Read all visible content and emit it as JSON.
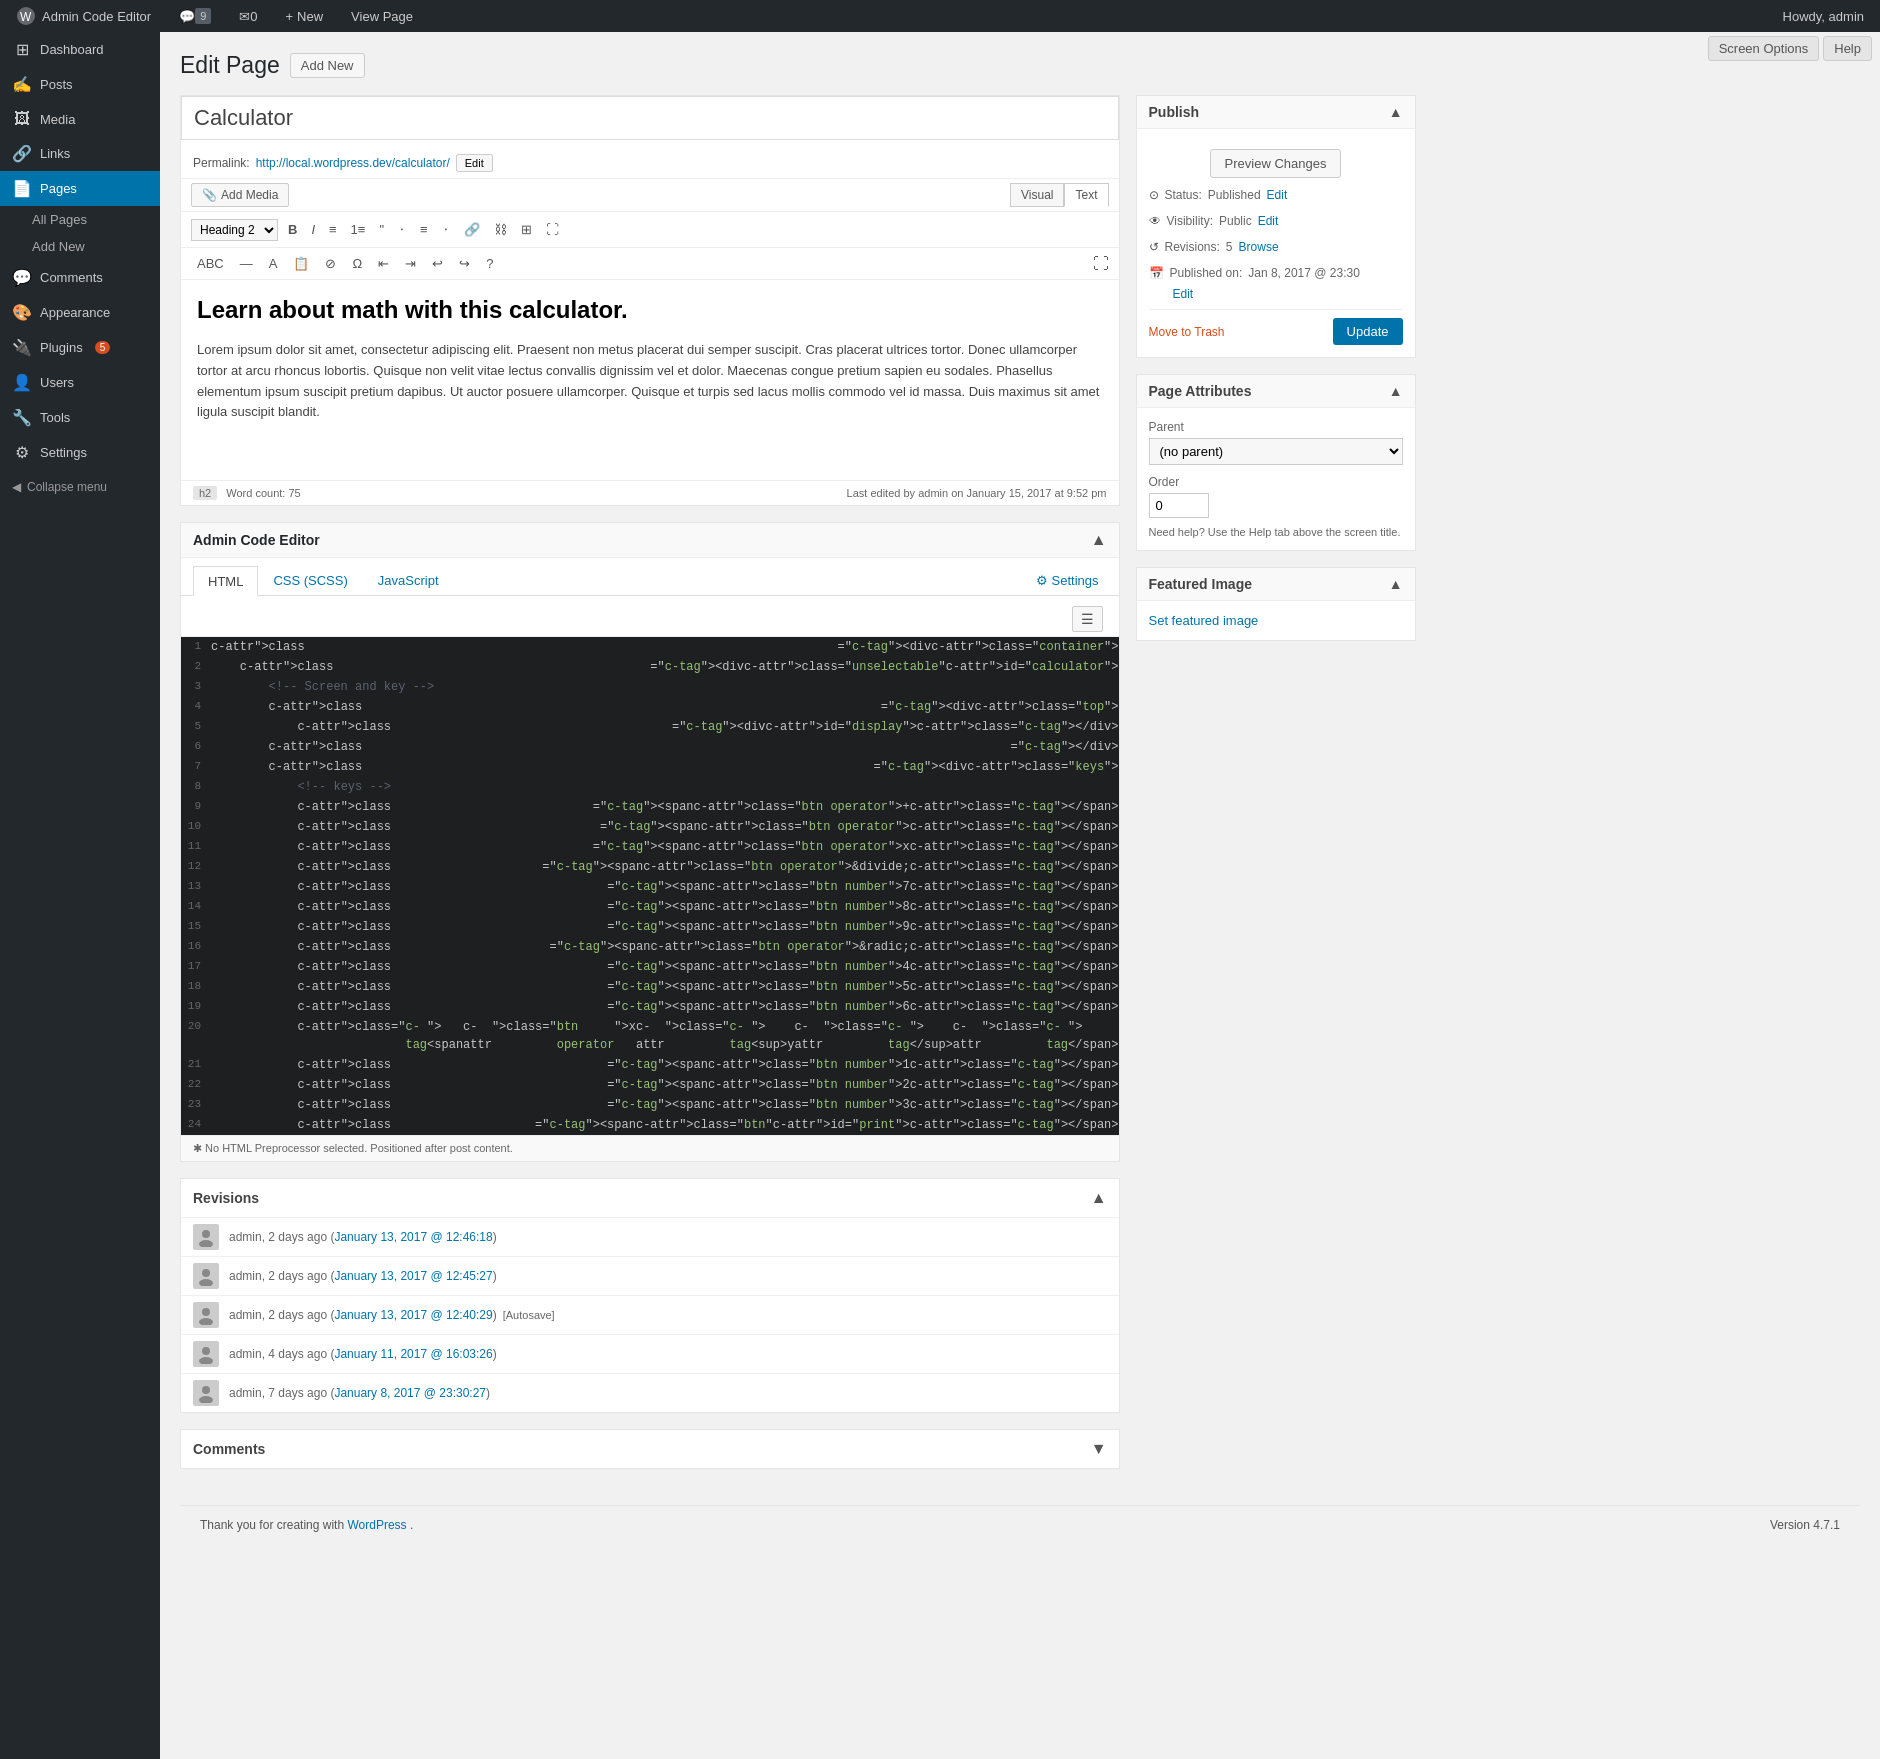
{
  "adminbar": {
    "site_name": "Admin Code Editor",
    "comments_count": "9",
    "new_label": "New",
    "view_page_label": "View Page",
    "screen_options_label": "Screen Options",
    "help_label": "Help",
    "howdy": "Howdy, admin"
  },
  "sidebar": {
    "items": [
      {
        "id": "dashboard",
        "label": "Dashboard",
        "icon": "⊞"
      },
      {
        "id": "posts",
        "label": "Posts",
        "icon": "✍"
      },
      {
        "id": "media",
        "label": "Media",
        "icon": "🖼"
      },
      {
        "id": "links",
        "label": "Links",
        "icon": "🔗"
      },
      {
        "id": "pages",
        "label": "Pages",
        "icon": "📄",
        "active": true
      },
      {
        "id": "comments",
        "label": "Comments",
        "icon": "💬"
      },
      {
        "id": "appearance",
        "label": "Appearance",
        "icon": "🎨"
      },
      {
        "id": "plugins",
        "label": "Plugins",
        "icon": "🔌",
        "badge": "5"
      },
      {
        "id": "users",
        "label": "Users",
        "icon": "👤"
      },
      {
        "id": "tools",
        "label": "Tools",
        "icon": "🔧"
      },
      {
        "id": "settings",
        "label": "Settings",
        "icon": "⚙"
      }
    ],
    "pages_submenu": [
      {
        "label": "All Pages"
      },
      {
        "label": "Add New"
      }
    ],
    "collapse_label": "Collapse menu"
  },
  "page": {
    "header": "Edit Page",
    "add_new": "Add New",
    "title": "Calculator",
    "permalink_label": "Permalink:",
    "permalink_url": "http://local.wordpress.dev/calculator/",
    "permalink_edit": "Edit",
    "add_media": "Add Media",
    "visual_tab": "Visual",
    "text_tab": "Text",
    "heading_select": "Heading 2",
    "editor_content": {
      "heading": "Learn about math with this calculator.",
      "body": "Lorem ipsum dolor sit amet, consectetur adipiscing elit. Praesent non metus placerat dui semper suscipit. Cras placerat ultrices tortor. Donec ullamcorper tortor at arcu rhoncus lobortis. Quisque non velit vitae lectus convallis dignissim vel et dolor. Maecenas congue pretium sapien eu sodales. Phasellus elementum ipsum suscipit pretium dapibus. Ut auctor posuere ullamcorper. Quisque et turpis sed lacus mollis commodo vel id massa. Duis maximus sit amet ligula suscipit blandit."
    },
    "tag_label": "h2",
    "word_count": "Word count: 75",
    "last_edited": "Last edited by admin on January 15, 2017 at 9:52 pm"
  },
  "code_editor": {
    "title": "Admin Code Editor",
    "tabs": [
      "HTML",
      "CSS (SCSS)",
      "JavaScript"
    ],
    "settings_label": "Settings",
    "active_tab": "HTML",
    "lines": [
      {
        "num": 1,
        "text": "<div class=\"container\">"
      },
      {
        "num": 2,
        "text": "    <div class=\"unselectable\" id=\"calculator\">"
      },
      {
        "num": 3,
        "text": "        <!-- Screen and key -->"
      },
      {
        "num": 4,
        "text": "        <div class=\"top\">"
      },
      {
        "num": 5,
        "text": "            <div id=\"display\"></div>"
      },
      {
        "num": 6,
        "text": "        </div>"
      },
      {
        "num": 7,
        "text": "        <div class=\"keys\">"
      },
      {
        "num": 8,
        "text": "            <!-- keys -->"
      },
      {
        "num": 9,
        "text": "            <span class=\"btn operator\">+</span>"
      },
      {
        "num": 10,
        "text": "            <span class=\"btn operator\"></span>"
      },
      {
        "num": 11,
        "text": "            <span class=\"btn operator\">x</span>"
      },
      {
        "num": 12,
        "text": "            <span class=\"btn operator\">&divide;</span>"
      },
      {
        "num": 13,
        "text": "            <span class=\"btn number\">7</span>"
      },
      {
        "num": 14,
        "text": "            <span class=\"btn number\">8</span>"
      },
      {
        "num": 15,
        "text": "            <span class=\"btn number\">9</span>"
      },
      {
        "num": 16,
        "text": "            <span class=\"btn operator\">&radic;</span>"
      },
      {
        "num": 17,
        "text": "            <span class=\"btn number\">4</span>"
      },
      {
        "num": 18,
        "text": "            <span class=\"btn number\">5</span>"
      },
      {
        "num": 19,
        "text": "            <span class=\"btn number\">6</span>"
      },
      {
        "num": 20,
        "text": "            <span class=\"btn operator\">x<sup>y</sup></span>"
      },
      {
        "num": 21,
        "text": "            <span class=\"btn number\">1</span>"
      },
      {
        "num": 22,
        "text": "            <span class=\"btn number\">2</span>"
      },
      {
        "num": 23,
        "text": "            <span class=\"btn number\">3</span>"
      },
      {
        "num": 24,
        "text": "            <span class=\"btn \" id=\"print\"></span>"
      }
    ],
    "footer_text": "✱ No HTML Preprocessor selected. Positioned after post content."
  },
  "publish": {
    "title": "Publish",
    "preview_btn": "Preview Changes",
    "status_label": "Status:",
    "status_value": "Published",
    "status_edit": "Edit",
    "visibility_label": "Visibility:",
    "visibility_value": "Public",
    "visibility_edit": "Edit",
    "revisions_label": "Revisions:",
    "revisions_value": "5",
    "revisions_browse": "Browse",
    "published_label": "Published on:",
    "published_value": "Jan 8, 2017 @ 23:30",
    "published_edit": "Edit",
    "trash_label": "Move to Trash",
    "update_btn": "Update"
  },
  "page_attributes": {
    "title": "Page Attributes",
    "parent_label": "Parent",
    "parent_value": "(no parent)",
    "order_label": "Order",
    "order_value": "0",
    "help_text": "Need help? Use the Help tab above the screen title."
  },
  "featured_image": {
    "title": "Featured Image",
    "set_link": "Set featured image"
  },
  "revisions": {
    "title": "Revisions",
    "items": [
      {
        "author": "admin",
        "time": "2 days ago",
        "date_link": "January 13, 2017 @ 12:46:18",
        "autosave": false
      },
      {
        "author": "admin",
        "time": "2 days ago",
        "date_link": "January 13, 2017 @ 12:45:27",
        "autosave": false
      },
      {
        "author": "admin",
        "time": "2 days ago",
        "date_link": "January 13, 2017 @ 12:40:29",
        "autosave": true
      },
      {
        "author": "admin",
        "time": "4 days ago",
        "date_link": "January 11, 2017 @ 16:03:26",
        "autosave": false
      },
      {
        "author": "admin",
        "time": "7 days ago",
        "date_link": "January 8, 2017 @ 23:30:27",
        "autosave": false
      }
    ],
    "autosave_label": "[Autosave]"
  },
  "comments_section": {
    "title": "Comments"
  },
  "footer": {
    "thank_you": "Thank you for creating with",
    "wordpress_link": "WordPress",
    "version": "Version 4.7.1"
  }
}
